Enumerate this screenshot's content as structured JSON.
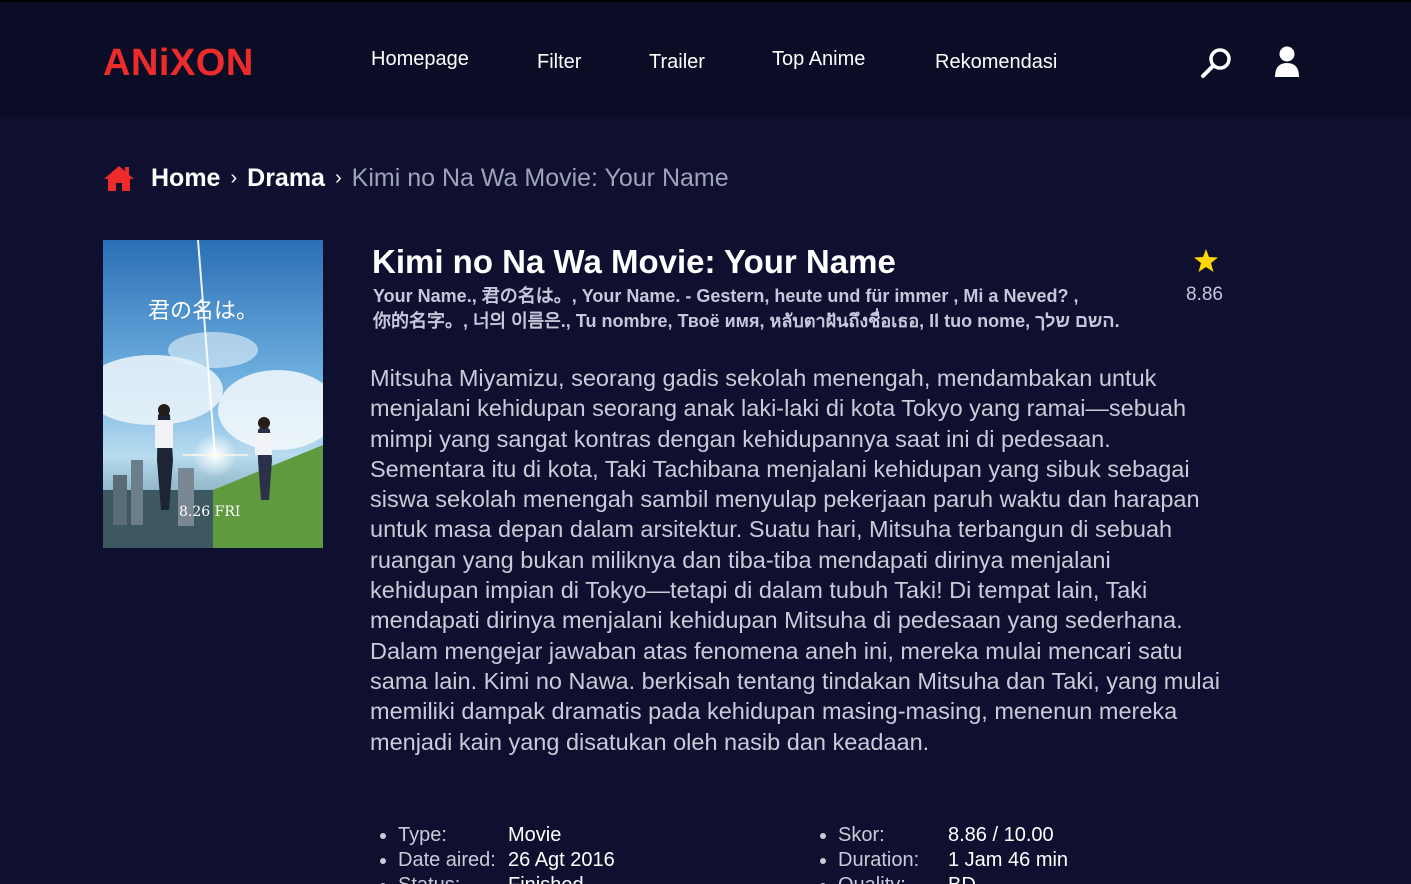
{
  "brand": {
    "logo": "ANiXON",
    "color": "#ee2b2b"
  },
  "nav": {
    "items": [
      "Homepage",
      "Filter",
      "Trailer",
      "Top Anime",
      "Rekomendasi"
    ],
    "icons": [
      "search-icon",
      "user-icon"
    ]
  },
  "breadcrumb": {
    "icon": "home-icon",
    "home": "Home",
    "separator": "›",
    "category": "Drama",
    "current": "Kimi no Na Wa Movie: Your Name"
  },
  "anime": {
    "poster": {
      "title_jp": "君の名は。",
      "date_text": "8.26 FRI"
    },
    "title": "Kimi no Na Wa Movie: Your Name",
    "alt_titles_line1": "Your Name., 君の名は。, Your Name. - Gestern, heute und für immer , Mi a Neved? ,",
    "alt_titles_line2": "你的名字。, 너의 이름은., Tu nombre, Твоё имя, หลับตาฝันถึงชื่อเธอ, Il tuo nome, השם שלך.",
    "rating": "8.86",
    "synopsis": "Mitsuha Miyamizu, seorang gadis sekolah menengah, mendambakan untuk menjalani kehidupan seorang anak laki-laki di kota Tokyo yang ramai—sebuah mimpi yang sangat kontras dengan kehidupannya saat ini di pedesaan. Sementara itu di kota, Taki Tachibana menjalani kehidupan yang sibuk sebagai siswa sekolah menengah sambil menyulap pekerjaan paruh waktu dan harapan untuk masa depan dalam arsitektur. Suatu hari, Mitsuha terbangun di sebuah ruangan yang bukan miliknya dan tiba-tiba mendapati dirinya menjalani kehidupan impian di Tokyo—tetapi di dalam tubuh Taki! Di tempat lain, Taki mendapati dirinya menjalani kehidupan Mitsuha di pedesaan yang sederhana. Dalam mengejar jawaban atas fenomena aneh ini, mereka mulai mencari satu sama lain. Kimi no Nawa. berkisah tentang tindakan Mitsuha dan Taki, yang mulai memiliki dampak dramatis pada kehidupan masing-masing, menenun mereka menjadi kain yang disatukan oleh nasib dan keadaan."
  },
  "info_left": [
    {
      "label": "Type:",
      "value": "Movie"
    },
    {
      "label": "Date aired:",
      "value": "26 Agt 2016"
    },
    {
      "label": "Status:",
      "value": "Finished"
    }
  ],
  "info_right": [
    {
      "label": "Skor:",
      "value": "8.86 / 10.00"
    },
    {
      "label": "Duration:",
      "value": "1 Jam 46 min"
    },
    {
      "label": "Quality:",
      "value": "BD"
    }
  ],
  "colors": {
    "background": "#0f1030",
    "header": "#0b0c25",
    "accent": "#ee2b2b",
    "star": "#ffd700"
  }
}
